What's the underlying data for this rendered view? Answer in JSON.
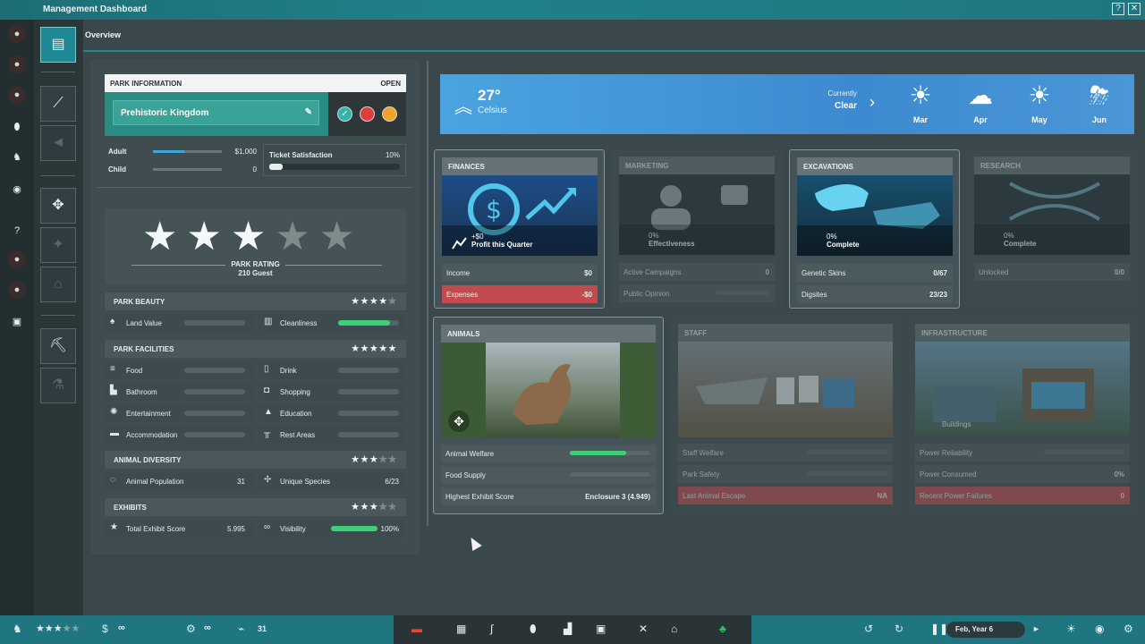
{
  "window": {
    "title": "Management Dashboard",
    "help": "?",
    "close": "✕"
  },
  "overview_label": "Overview",
  "park_info": {
    "header": "PARK INFORMATION",
    "status": "OPEN",
    "name": "Prehistoric Kingdom",
    "tickets": [
      {
        "label": "Adult",
        "value": "$1,000",
        "fill": 0.45
      },
      {
        "label": "Child",
        "value": "0",
        "fill": 0
      }
    ],
    "ticket_satisfaction": {
      "label": "Ticket Satisfaction",
      "value": "10%",
      "fill": 0.1
    }
  },
  "rating": {
    "stars": 3,
    "of": 5,
    "label": "PARK RATING",
    "guests": "210 Guest"
  },
  "sections": {
    "beauty": {
      "title": "PARK BEAUTY",
      "stars": 4,
      "items": [
        {
          "label": "Land Value",
          "icon": "tree-icon",
          "fill": 0
        },
        {
          "label": "Cleanliness",
          "icon": "bin-icon",
          "fill": 0.85
        }
      ]
    },
    "facilities": {
      "title": "PARK FACILITIES",
      "stars": 5,
      "items": [
        {
          "label": "Food",
          "icon": "burger-icon"
        },
        {
          "label": "Drink",
          "icon": "cup-icon"
        },
        {
          "label": "Bathroom",
          "icon": "toilet-icon"
        },
        {
          "label": "Shopping",
          "icon": "bag-icon"
        },
        {
          "label": "Entertainment",
          "icon": "sparkle-icon"
        },
        {
          "label": "Education",
          "icon": "graduation-icon"
        },
        {
          "label": "Accommodation",
          "icon": "bed-icon"
        },
        {
          "label": "Rest Areas",
          "icon": "bench-icon"
        }
      ]
    },
    "diversity": {
      "title": "ANIMAL DIVERSITY",
      "stars": 3,
      "items": [
        {
          "label": "Animal Population",
          "value": "31"
        },
        {
          "label": "Unique Species",
          "value": "6/23"
        }
      ]
    },
    "exhibits": {
      "title": "EXHIBITS",
      "stars": 3,
      "items": [
        {
          "label": "Total Exhibit Score",
          "value": "5.995"
        },
        {
          "label": "Visibility",
          "value": "100%",
          "fill": 1
        }
      ]
    }
  },
  "weather": {
    "temp": "27°",
    "unit": "Celsius",
    "current_label": "Currently",
    "current": "Clear",
    "forecast": [
      {
        "month": "Mar",
        "icon": "sun-icon"
      },
      {
        "month": "Apr",
        "icon": "cloud-icon"
      },
      {
        "month": "May",
        "icon": "sun-icon"
      },
      {
        "month": "Jun",
        "icon": "storm-icon"
      }
    ]
  },
  "cards": {
    "finances": {
      "title": "FINANCES",
      "img_value": "+$0",
      "img_label": "Profit this Quarter",
      "rows": [
        {
          "label": "Income",
          "value": "$0"
        },
        {
          "label": "Expenses",
          "value": "-$0"
        }
      ]
    },
    "marketing": {
      "title": "MARKETING",
      "img_value": "0%",
      "img_label": "Effectiveness",
      "rows": [
        {
          "label": "Active Campaigns",
          "value": "0"
        },
        {
          "label": "Public Opinion",
          "value": ""
        }
      ]
    },
    "excavations": {
      "title": "EXCAVATIONS",
      "img_value": "0%",
      "img_label": "Complete",
      "rows": [
        {
          "label": "Genetic Skins",
          "value": "0/67"
        },
        {
          "label": "Digsites",
          "value": "23/23"
        }
      ]
    },
    "research": {
      "title": "RESEARCH",
      "img_value": "0%",
      "img_label": "Complete",
      "rows": [
        {
          "label": "Unlocked",
          "value": "0/0"
        }
      ]
    },
    "animals": {
      "title": "ANIMALS",
      "rows": [
        {
          "label": "Animal Welfare",
          "fill": 0.7
        },
        {
          "label": "Food Supply",
          "fill": 0
        },
        {
          "label": "Highest Exhibit Score",
          "value": "Enclosure 3 (4.949)"
        }
      ]
    },
    "staff": {
      "title": "STAFF",
      "rows": [
        {
          "label": "Staff Welfare"
        },
        {
          "label": "Park Safety"
        },
        {
          "label": "Last Animal Escape",
          "value": "NA"
        }
      ]
    },
    "infrastructure": {
      "title": "INFRASTRUCTURE",
      "img_caption": "Buildings",
      "rows": [
        {
          "label": "Power Reliability"
        },
        {
          "label": "Power Consumed",
          "value": "0%"
        },
        {
          "label": "Recent Power Failures",
          "value": "0"
        }
      ]
    }
  },
  "bottom": {
    "money": "∞",
    "research": "∞",
    "animals": "31",
    "date": "Feb, Year 6"
  }
}
